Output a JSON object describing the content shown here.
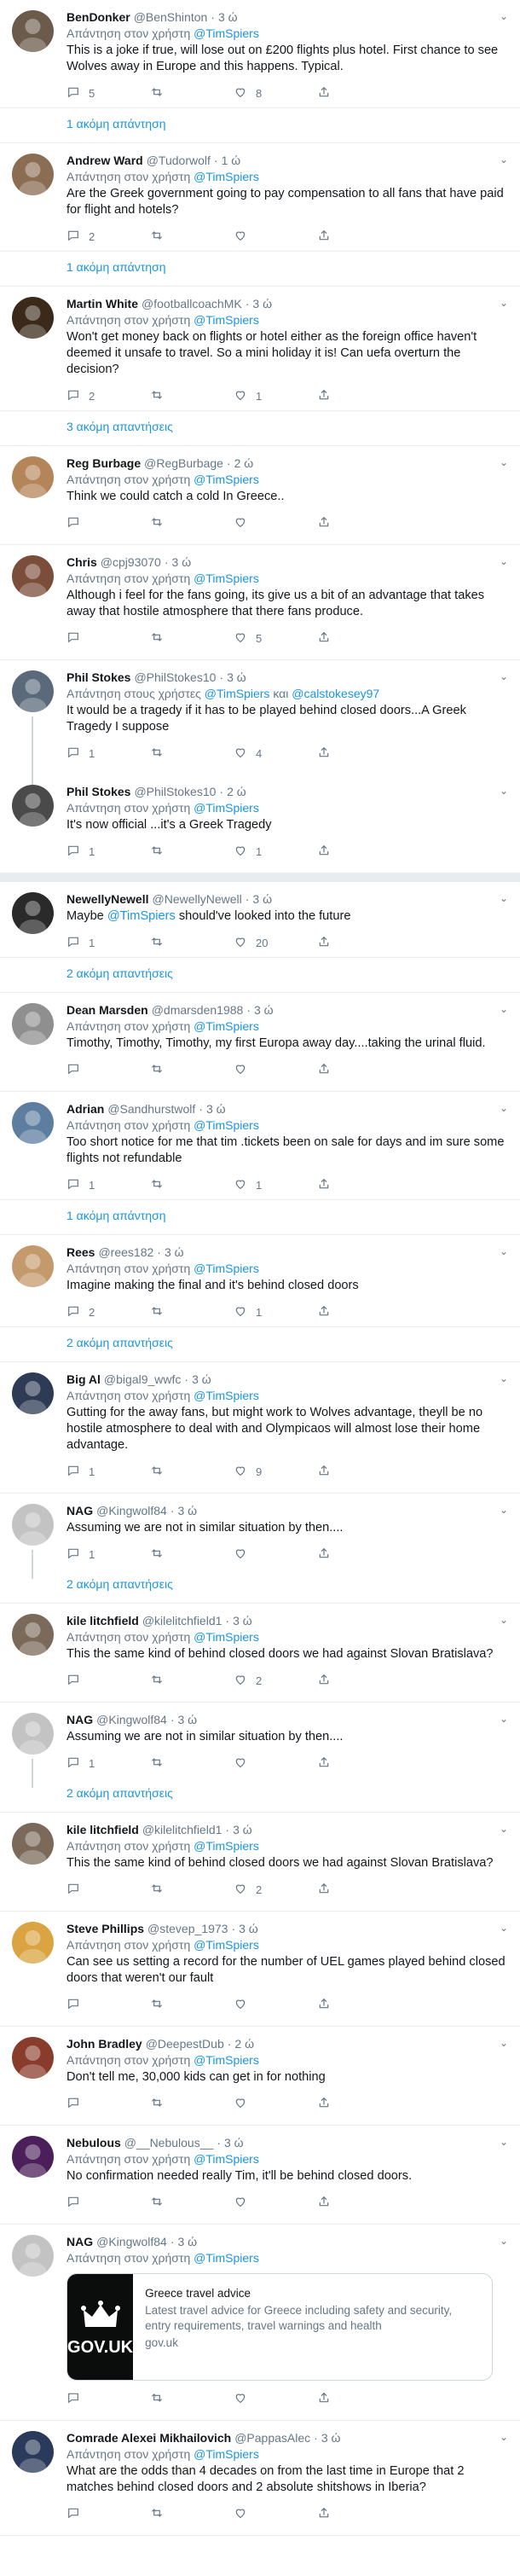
{
  "ui": {
    "reply_to_prefix": "Απάντηση στον χρήστη",
    "reply_to_multi_prefix": "Απάντηση στους χρήστες",
    "and": "και",
    "dot": "·",
    "caret": "⌄"
  },
  "colors": {
    "link": "#1b95e0",
    "muted": "#657786",
    "text": "#14171a",
    "border": "#e6ecf0"
  },
  "tweets": [
    {
      "name": "BenDonker",
      "handle": "@BenShinton",
      "time": "3 ώ",
      "reply_to": "@TimSpiers",
      "text": "This is a joke if true, will lose out on £200 flights plus hotel. First chance to see Wolves away in Europe and this happens. Typical.",
      "replies": "5",
      "retweets": "",
      "likes": "8",
      "more": "1 ακόμη απάντηση"
    },
    {
      "name": "Andrew Ward",
      "handle": "@Tudorwolf",
      "time": "1 ώ",
      "reply_to": "@TimSpiers",
      "text": "Are the Greek government going to pay compensation to all fans that have paid for flight and hotels?",
      "replies": "2",
      "retweets": "",
      "likes": "",
      "more": "1 ακόμη απάντηση"
    },
    {
      "name": "Martin White",
      "handle": "@footballcoachMK",
      "time": "3 ώ",
      "reply_to": "@TimSpiers",
      "text": "Won't get money back on flights or hotel either as the foreign office haven't deemed it unsafe to travel. So a mini holiday it is! Can uefa overturn the decision?",
      "replies": "2",
      "retweets": "",
      "likes": "1",
      "more": "3 ακόμη απαντήσεις"
    },
    {
      "name": "Reg Burbage",
      "handle": "@RegBurbage",
      "time": "2 ώ",
      "reply_to": "@TimSpiers",
      "text": "Think we could catch a cold In Greece..",
      "replies": "",
      "retweets": "",
      "likes": "",
      "more": ""
    },
    {
      "name": "Chris",
      "handle": "@cpj93070",
      "time": "3 ώ",
      "reply_to": "@TimSpiers",
      "text": "Although i feel for the fans going, its give us a bit of an advantage that takes away that hostile atmosphere that there fans produce.",
      "replies": "",
      "retweets": "",
      "likes": "5",
      "more": ""
    },
    {
      "name": "Phil Stokes",
      "handle": "@PhilStokes10",
      "time": "3 ώ",
      "reply_to_multi": "@TimSpiers",
      "reply_to_multi2": "@calstokesey97",
      "text": "It would be a tragedy if it has to be played behind closed doors...A Greek Tragedy I suppose",
      "replies": "1",
      "retweets": "",
      "likes": "4",
      "more": ""
    },
    {
      "name": "Phil Stokes",
      "handle": "@PhilStokes10",
      "time": "2 ώ",
      "reply_to": "@TimSpiers",
      "text": "It's now official ...it's a Greek Tragedy",
      "replies": "1",
      "retweets": "",
      "likes": "1",
      "more": ""
    },
    {
      "name": "NewellyNewell",
      "handle": "@NewellyNewell",
      "time": "3 ώ",
      "text_prefix": "Maybe ",
      "text_mention": "@TimSpiers",
      "text_suffix": " should've looked into the future",
      "replies": "1",
      "retweets": "",
      "likes": "20",
      "more": "2 ακόμη απαντήσεις"
    },
    {
      "name": "Dean Marsden",
      "handle": "@dmarsden1988",
      "time": "3 ώ",
      "reply_to": "@TimSpiers",
      "text": "Timothy, Timothy, Timothy, my first Europa away day....taking the urinal fluid.",
      "replies": "",
      "retweets": "",
      "likes": "",
      "more": ""
    },
    {
      "name": "Adrian",
      "handle": "@Sandhurstwolf",
      "time": "3 ώ",
      "reply_to": "@TimSpiers",
      "text": "Too short notice for me that tim .tickets been on sale for days and im sure some flights not refundable",
      "replies": "1",
      "retweets": "",
      "likes": "1",
      "more": "1 ακόμη απάντηση"
    },
    {
      "name": "Rees",
      "handle": "@rees182",
      "time": "3 ώ",
      "reply_to": "@TimSpiers",
      "text": "Imagine making the final and it's behind closed doors",
      "replies": "2",
      "retweets": "",
      "likes": "1",
      "more": "2 ακόμη απαντήσεις"
    },
    {
      "name": "Big Al",
      "handle": "@bigal9_wwfc",
      "time": "3 ώ",
      "reply_to": "@TimSpiers",
      "text": "Gutting for the away fans, but might work to Wolves advantage, theyll be no hostile atmosphere to deal with and Olympicaos will almost lose their home advantage.",
      "replies": "1",
      "retweets": "",
      "likes": "9",
      "more": ""
    },
    {
      "name": "NAG",
      "handle": "@Kingwolf84",
      "time": "3 ώ",
      "text": "Assuming we are not in similar situation by then....",
      "replies": "1",
      "retweets": "",
      "likes": "",
      "more": "2 ακόμη απαντήσεις"
    },
    {
      "name": "kile litchfield",
      "handle": "@kilelitchfield1",
      "time": "3 ώ",
      "reply_to": "@TimSpiers",
      "text": "This the same kind of behind closed doors we had against Slovan Bratislava?",
      "replies": "",
      "retweets": "",
      "likes": "2",
      "more": ""
    },
    {
      "name": "NAG",
      "handle": "@Kingwolf84",
      "time": "3 ώ",
      "text": "Assuming we are not in similar situation by then....",
      "replies": "1",
      "retweets": "",
      "likes": "",
      "more": "2 ακόμη απαντήσεις"
    },
    {
      "name": "kile litchfield",
      "handle": "@kilelitchfield1",
      "time": "3 ώ",
      "reply_to": "@TimSpiers",
      "text": "This the same kind of behind closed doors we had against Slovan Bratislava?",
      "replies": "",
      "retweets": "",
      "likes": "2",
      "more": ""
    },
    {
      "name": "Steve Phillips",
      "handle": "@stevep_1973",
      "time": "3 ώ",
      "reply_to": "@TimSpiers",
      "text": "Can see us setting a record for the number of UEL games played behind closed doors that weren't our fault",
      "replies": "",
      "retweets": "",
      "likes": "",
      "more": ""
    },
    {
      "name": "John Bradley",
      "handle": "@DeepestDub",
      "time": "2 ώ",
      "reply_to": "@TimSpiers",
      "text": "Don't tell me, 30,000 kids can get in for nothing",
      "replies": "",
      "retweets": "",
      "likes": "",
      "more": ""
    },
    {
      "name": "Nebulous",
      "handle": "@__Nebulous__",
      "time": "3 ώ",
      "reply_to": "@TimSpiers",
      "text": "No confirmation needed really Tim, it'll be behind closed doors.",
      "replies": "",
      "retweets": "",
      "likes": "",
      "more": ""
    },
    {
      "name": "NAG",
      "handle": "@Kingwolf84",
      "time": "3 ώ",
      "reply_to": "@TimSpiers",
      "text": "",
      "card": {
        "logo_text": "GOV.UK",
        "title": "Greece travel advice",
        "desc": "Latest travel advice for Greece including safety and security, entry requirements, travel warnings and health",
        "link": "gov.uk"
      },
      "replies": "",
      "retweets": "",
      "likes": "",
      "more": ""
    },
    {
      "name": "Comrade Alexei Mikhailovich",
      "handle": "@PappasAlec",
      "time": "3 ώ",
      "reply_to": "@TimSpiers",
      "text": "What are the odds than 4 decades on from the last time in Europe that 2 matches behind closed doors and 2 absolute shitshows in Iberia?",
      "replies": "",
      "retweets": "",
      "likes": "",
      "more": ""
    }
  ]
}
